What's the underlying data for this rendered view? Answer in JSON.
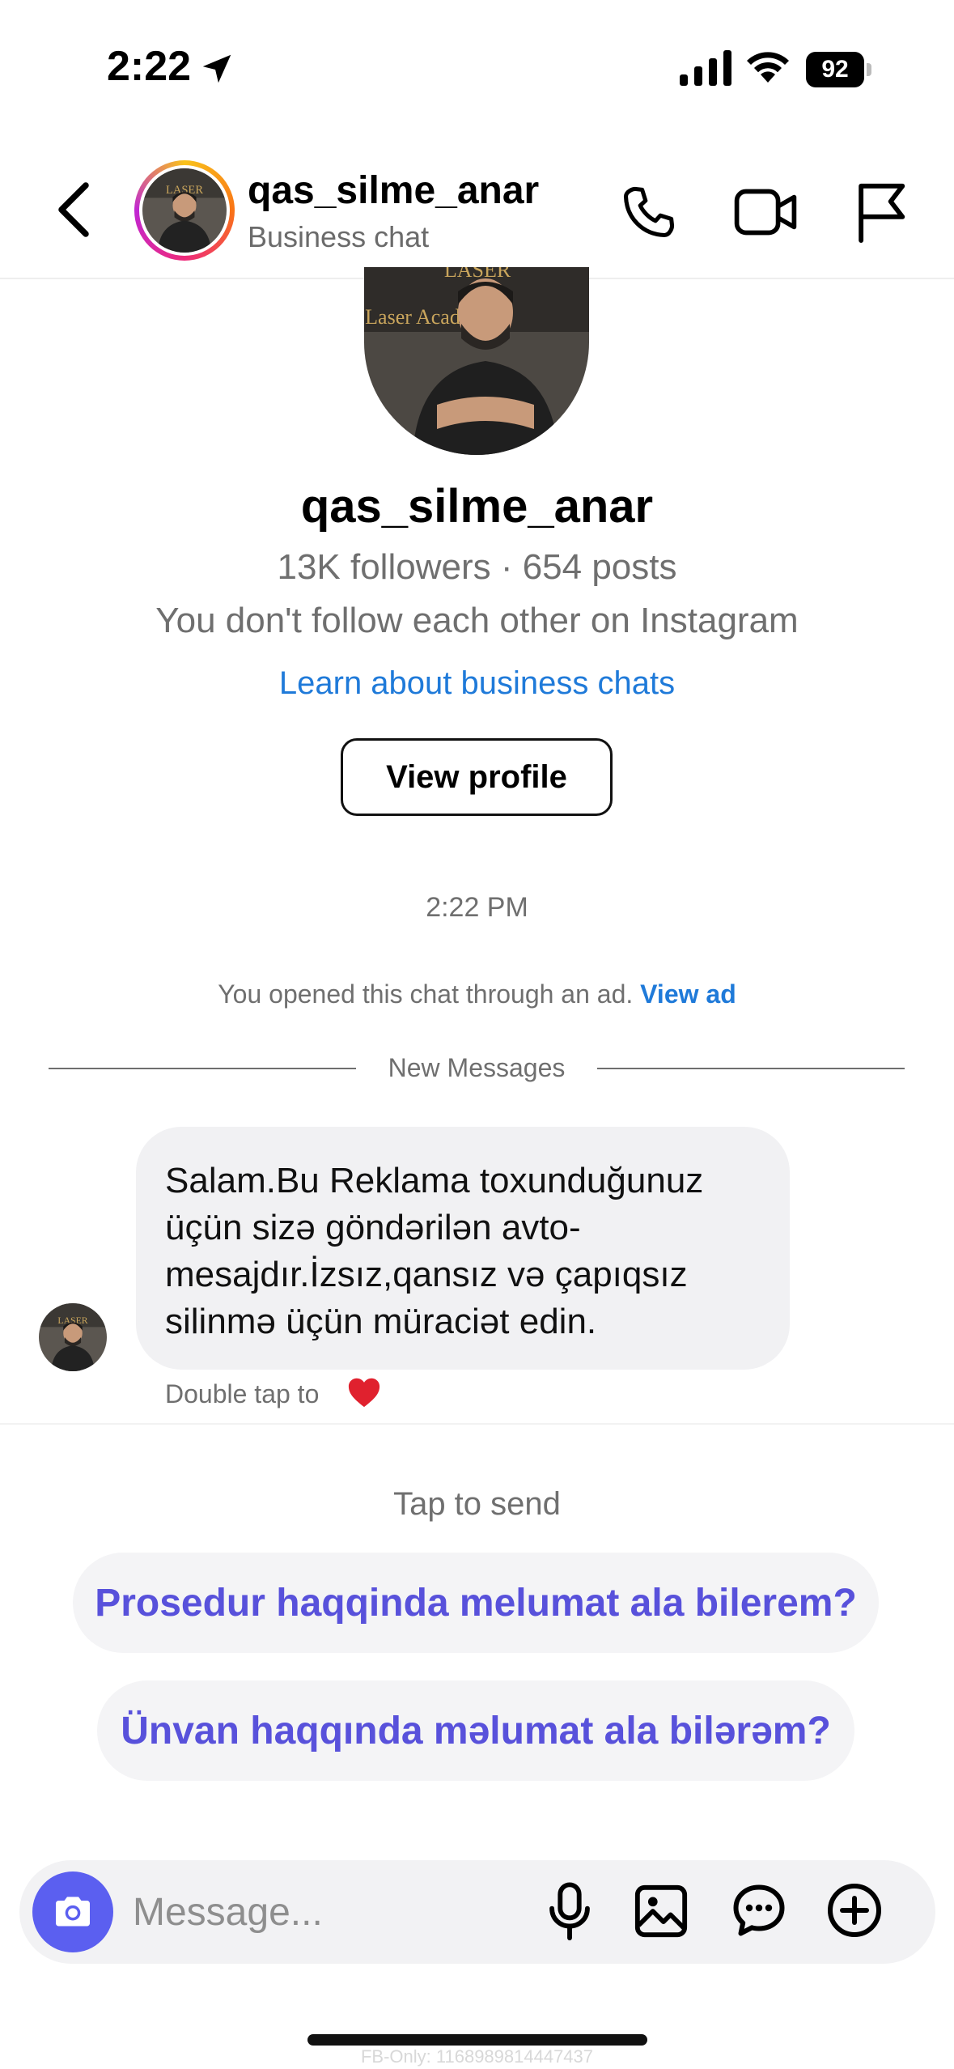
{
  "status_bar": {
    "time": "2:22",
    "battery": "92",
    "icons": [
      "location-arrow-icon",
      "cellular-signal-icon",
      "wifi-icon",
      "battery-icon"
    ]
  },
  "header": {
    "username": "qas_silme_anar",
    "subtitle": "Business chat",
    "icons": [
      "chevron-left-icon",
      "phone-icon",
      "video-camera-icon",
      "flag-icon"
    ],
    "avatar_ring_colors": [
      "#f9c21b",
      "#f97316",
      "#ee2a7b",
      "#c026d3"
    ]
  },
  "profile": {
    "username": "qas_silme_anar",
    "stats": "13K followers · 654 posts",
    "follow_status": "You don't follow each other on Instagram",
    "learn_link": "Learn about business chats",
    "view_profile_label": "View profile"
  },
  "chat": {
    "timestamp": "2:22 PM",
    "ad_notice": "You opened this chat through an ad.",
    "ad_link": "View ad",
    "new_messages_label": "New Messages",
    "messages": [
      {
        "from": "qas_silme_anar",
        "lines": [
          "Salam.Bu Reklama toxunduğunuz",
          "üçün sizə göndərilən avto-",
          "mesajdır.İzsız,qansız və çapıqsız",
          "silinmə üçün müraciət edin."
        ]
      }
    ],
    "double_tap_hint": "Double tap to"
  },
  "quick_replies": {
    "heading": "Tap to send",
    "items": [
      "Prosedur haqqinda melumat ala bilerem?",
      "Ünvan haqqında məlumat ala bilərəm?"
    ]
  },
  "composer": {
    "placeholder": "Message...",
    "icons": [
      "camera-icon",
      "microphone-icon",
      "gallery-icon",
      "sticker-icon",
      "plus-icon"
    ]
  },
  "footer": {
    "build_label": "FB-Only: 1168989814447437"
  },
  "colors": {
    "link_blue": "#1f7ad9",
    "quick_reply_purple": "#5851db",
    "camera_button": "#5b5ff0",
    "bubble_bg": "#f1f1f3",
    "heart_red": "#e0212e"
  }
}
